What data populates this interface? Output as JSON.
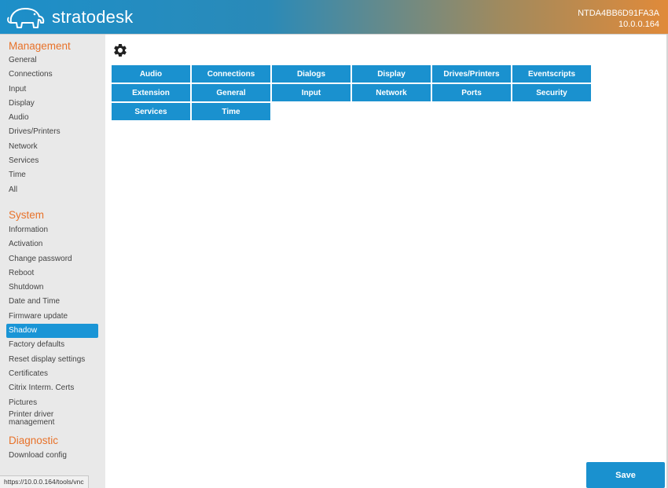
{
  "header": {
    "logo_text": "stratodesk",
    "hostname": "NTDA4BB6D91FA3A",
    "ip": "10.0.0.164"
  },
  "sidebar": {
    "management": {
      "title": "Management",
      "items": [
        "General",
        "Connections",
        "Input",
        "Display",
        "Audio",
        "Drives/Printers",
        "Network",
        "Services",
        "Time",
        "All"
      ]
    },
    "system": {
      "title": "System",
      "items": [
        "Information",
        "Activation",
        "Change password",
        "Reboot",
        "Shutdown",
        "Date and Time",
        "Firmware update",
        "Shadow",
        "Factory defaults",
        "Reset display settings",
        "Certificates",
        "Citrix Interm. Certs",
        "Pictures",
        "Printer driver management"
      ],
      "active": "Shadow"
    },
    "diagnostic": {
      "title": "Diagnostic",
      "items": [
        "Download config"
      ]
    }
  },
  "status_url": "https://10.0.0.164/tools/vnc",
  "main": {
    "settings_icon": "gear-icon",
    "categories": [
      "Audio",
      "Connections",
      "Dialogs",
      "Display",
      "Drives/Printers",
      "Eventscripts",
      "Extension",
      "General",
      "Input",
      "Network",
      "Ports",
      "Security",
      "Services",
      "Time"
    ]
  },
  "save_label": "Save",
  "colors": {
    "accent_orange": "#e8722a",
    "button_blue": "#1a91cf",
    "active_blue": "#1a95d6",
    "sidebar_bg": "#e9e9e9"
  }
}
